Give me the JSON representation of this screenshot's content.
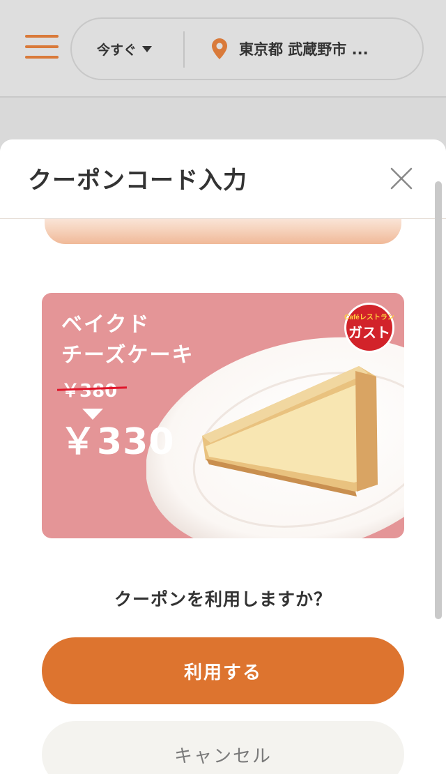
{
  "topbar": {
    "time_label": "今すぐ",
    "location_label": "東京都 武蔵野市 ..."
  },
  "modal": {
    "title": "クーポンコード入力",
    "coupon": {
      "name_line1": "ベイクド",
      "name_line2": "チーズケーキ",
      "old_price": "￥380",
      "new_price": "￥330",
      "brand_small": "Caféレストラン",
      "brand_large": "ガスト"
    },
    "question": "クーポンを利用しますか？",
    "use_label": "利用する",
    "cancel_label": "キャンセル"
  },
  "colors": {
    "accent": "#dd742f",
    "banner": "#e49597",
    "logo_red": "#d2232a"
  },
  "icons": {
    "menu": "hamburger-menu-icon",
    "dropdown": "caret-down-icon",
    "location": "map-pin-icon",
    "close": "close-icon"
  }
}
